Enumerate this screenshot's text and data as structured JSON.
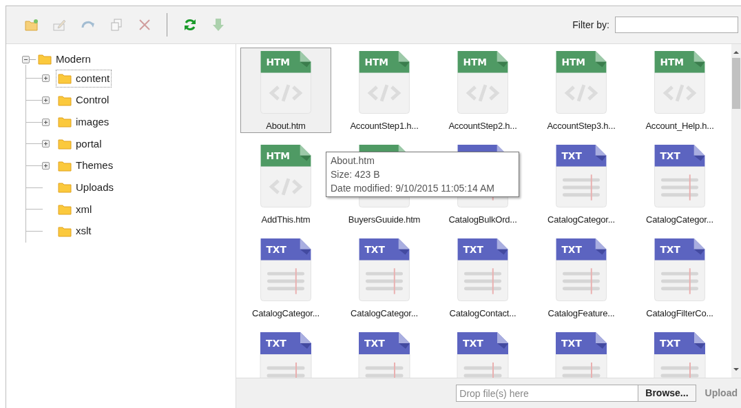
{
  "toolbar": {
    "buttons": [
      {
        "kind": "new-folder",
        "disabled": false
      },
      {
        "kind": "rename",
        "disabled": true
      },
      {
        "kind": "move",
        "disabled": true
      },
      {
        "kind": "copy",
        "disabled": true
      },
      {
        "kind": "delete",
        "disabled": true
      },
      {
        "kind": "separator"
      },
      {
        "kind": "refresh",
        "disabled": false
      },
      {
        "kind": "download",
        "disabled": true
      }
    ],
    "filter": {
      "label": "Filter by:"
    }
  },
  "tree": {
    "label": "Modern",
    "expanded": true,
    "selected": false,
    "children": [
      {
        "label": "content",
        "expandable": true,
        "selected": true
      },
      {
        "label": "Control",
        "expandable": true,
        "selected": false
      },
      {
        "label": "images",
        "expandable": true,
        "selected": false
      },
      {
        "label": "portal",
        "expandable": true,
        "selected": false
      },
      {
        "label": "Themes",
        "expandable": true,
        "selected": false
      },
      {
        "label": "Uploads",
        "expandable": false,
        "selected": false
      },
      {
        "label": "xml",
        "expandable": false,
        "selected": false
      },
      {
        "label": "xslt",
        "expandable": false,
        "selected": false
      }
    ]
  },
  "files": [
    {
      "kind": "htm",
      "badge": "HTM",
      "name": "About.htm",
      "selected": true
    },
    {
      "kind": "htm",
      "badge": "HTM",
      "name": "AccountStep1.h...",
      "selected": false
    },
    {
      "kind": "htm",
      "badge": "HTM",
      "name": "AccountStep2.h...",
      "selected": false
    },
    {
      "kind": "htm",
      "badge": "HTM",
      "name": "AccountStep3.h...",
      "selected": false
    },
    {
      "kind": "htm",
      "badge": "HTM",
      "name": "Account_Help.h...",
      "selected": false
    },
    {
      "kind": "htm",
      "badge": "HTM",
      "name": "AddThis.htm",
      "selected": false
    },
    {
      "kind": "htm",
      "name": "BuyersGuuide.htm",
      "selected": false
    },
    {
      "kind": "txt",
      "name": "CatalogBulkOrd...",
      "selected": false
    },
    {
      "kind": "txt",
      "badge": "TXT",
      "name": "CatalogCategor...",
      "selected": false
    },
    {
      "kind": "txt",
      "badge": "TXT",
      "name": "CatalogCategor...",
      "selected": false
    },
    {
      "kind": "txt",
      "badge": "TXT",
      "name": "CatalogCategor...",
      "selected": false
    },
    {
      "kind": "txt",
      "badge": "TXT",
      "name": "CatalogCategor...",
      "selected": false
    },
    {
      "kind": "txt",
      "badge": "TXT",
      "name": "CatalogContact...",
      "selected": false
    },
    {
      "kind": "txt",
      "badge": "TXT",
      "name": "CatalogFeature...",
      "selected": false
    },
    {
      "kind": "txt",
      "badge": "TXT",
      "name": "CatalogFilterCo...",
      "selected": false
    },
    {
      "kind": "txt",
      "badge": "TXT",
      "selected": false
    },
    {
      "kind": "txt",
      "badge": "TXT",
      "selected": false
    },
    {
      "kind": "txt",
      "badge": "TXT",
      "selected": false
    },
    {
      "kind": "txt",
      "badge": "TXT",
      "selected": false
    },
    {
      "kind": "txt",
      "badge": "TXT",
      "selected": false
    }
  ],
  "tooltip": {
    "lines": [
      "About.htm",
      "Size: 423 B",
      "Date modified: 9/10/2015 11:05:14 AM"
    ]
  },
  "upload": {
    "placeholder": "Drop file(s) here",
    "browse": "Browse...",
    "upload": "Upload",
    "upload_disabled": true
  }
}
